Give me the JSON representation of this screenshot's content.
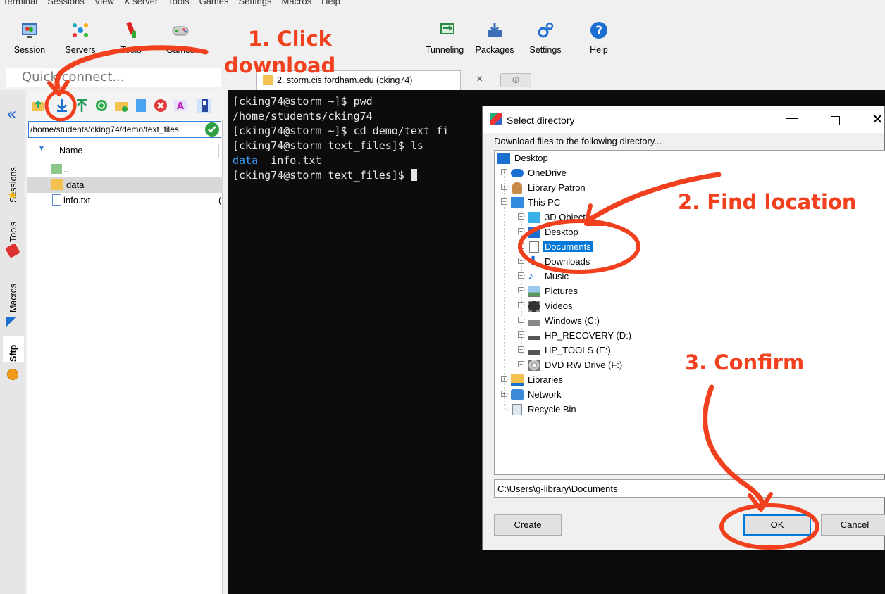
{
  "menu": [
    "Terminal",
    "Sessions",
    "View",
    "X server",
    "Tools",
    "Games",
    "Settings",
    "Macros",
    "Help"
  ],
  "toolbar": {
    "session": "Session",
    "servers": "Servers",
    "tools": "Tools",
    "games": "Games",
    "tunneling": "Tunneling",
    "packages": "Packages",
    "settings": "Settings",
    "help": "Help"
  },
  "quick_connect": {
    "placeholder": "Quick connect..."
  },
  "side_tabs": {
    "sessions": "Sessions",
    "tools": "Tools",
    "macros": "Macros",
    "sftp": "Sftp"
  },
  "sftp": {
    "path": "/home/students/cking74/demo/text_files",
    "name_header": "Name",
    "files": [
      {
        "name": "..",
        "size": ""
      },
      {
        "name": "data",
        "size": ""
      },
      {
        "name": "info.txt",
        "size": "("
      }
    ]
  },
  "terminal": {
    "tab_label": "2. storm.cis.fordham.edu (cking74)",
    "lines": [
      "[cking74@storm ~]$ pwd",
      "/home/students/cking74",
      "[cking74@storm ~]$ cd demo/text_fi",
      "[cking74@storm text_files]$ ls"
    ],
    "ls_output": [
      "data",
      "info.txt"
    ],
    "prompt": "[cking74@storm text_files]$ "
  },
  "dialog": {
    "title": "Select directory",
    "prompt": "Download files to the following directory...",
    "tree": [
      {
        "label": "Desktop",
        "icon": "desktop-icon"
      },
      {
        "label": "OneDrive",
        "icon": "cloud-icon"
      },
      {
        "label": "Library Patron",
        "icon": "user-icon"
      },
      {
        "label": "This PC",
        "icon": "computer-icon"
      },
      {
        "label": "3D Objects",
        "icon": "cube-icon"
      },
      {
        "label": "Desktop",
        "icon": "desktop-icon"
      },
      {
        "label": "Documents",
        "icon": "document-icon"
      },
      {
        "label": "Downloads",
        "icon": "download-icon"
      },
      {
        "label": "Music",
        "icon": "music-icon"
      },
      {
        "label": "Pictures",
        "icon": "pictures-icon"
      },
      {
        "label": "Videos",
        "icon": "videos-icon"
      },
      {
        "label": "Windows  (C:)",
        "icon": "drive-icon"
      },
      {
        "label": "HP_RECOVERY (D:)",
        "icon": "drive-icon"
      },
      {
        "label": "HP_TOOLS (E:)",
        "icon": "drive-icon"
      },
      {
        "label": "DVD RW Drive (F:)",
        "icon": "dvd-icon"
      },
      {
        "label": "Libraries",
        "icon": "library-icon"
      },
      {
        "label": "Network",
        "icon": "network-icon"
      },
      {
        "label": "Recycle Bin",
        "icon": "recycle-bin-icon"
      }
    ],
    "selected": "Documents",
    "path_value": "C:\\Users\\g-library\\Documents",
    "create": "Create",
    "ok": "OK",
    "cancel": "Cancel"
  },
  "annotations": {
    "step1_line1": "1. Click",
    "step1_line2": "download",
    "step2": "2. Find location",
    "step3": "3. Confirm"
  },
  "colors": {
    "annotation": "#f0401e",
    "selection": "#0078d7",
    "terminal_bg": "#0c0c0c",
    "terminal_blue": "#3aa0ff"
  }
}
